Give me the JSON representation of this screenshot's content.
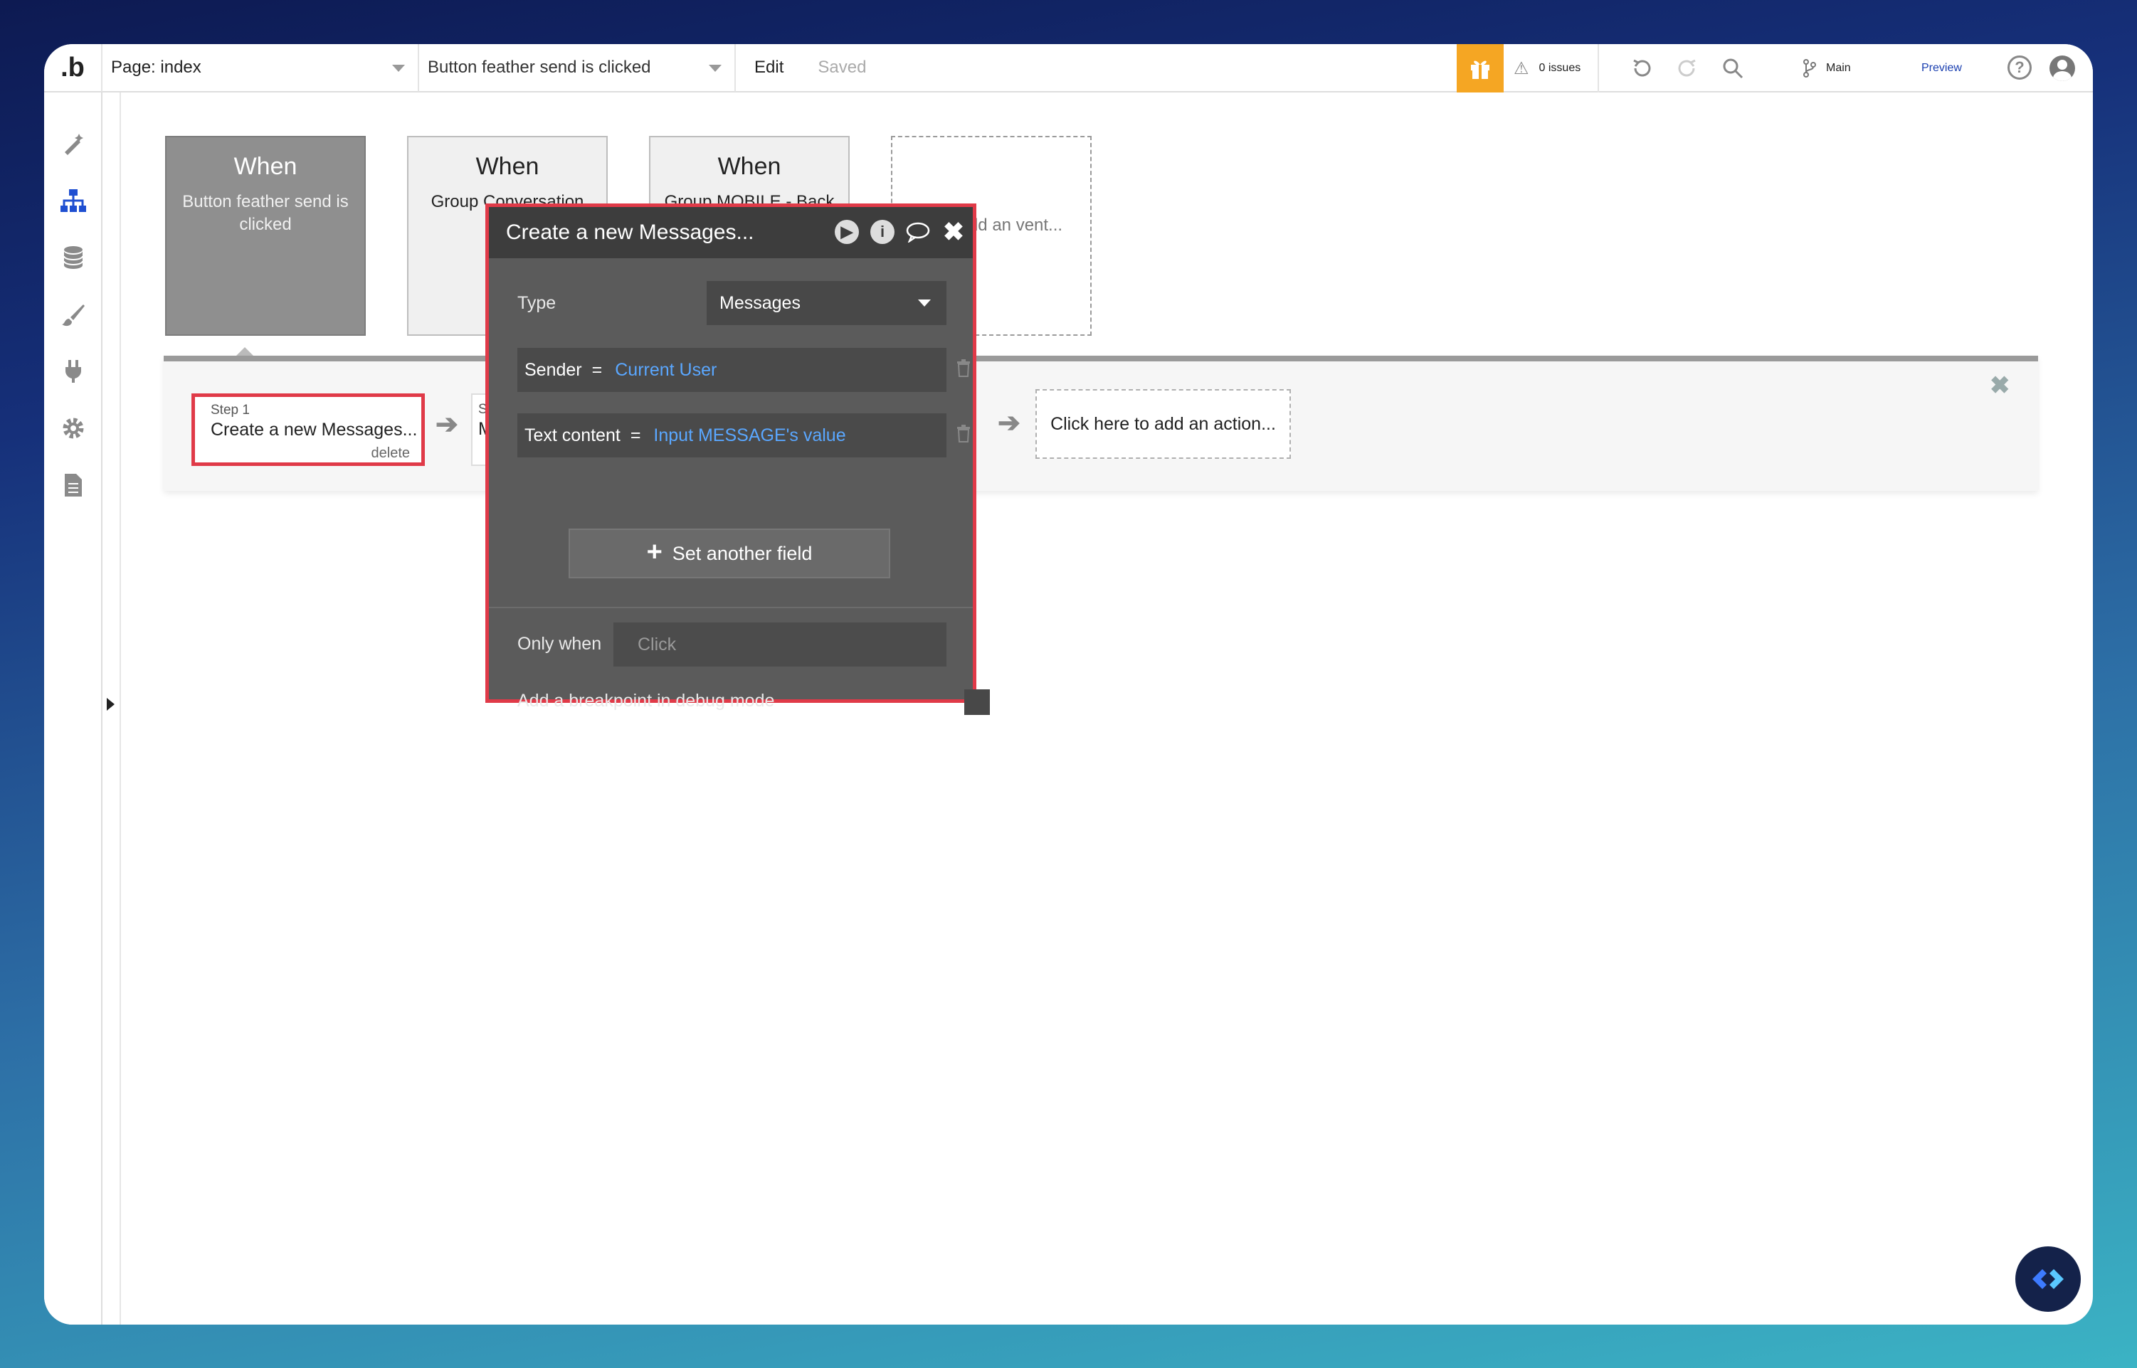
{
  "topbar": {
    "logo": ".b",
    "page_selector": "Page: index",
    "workflow_selector": "Button feather send is clicked",
    "edit": "Edit",
    "saved": "Saved",
    "issues": "0 issues",
    "branch": "Main",
    "preview": "Preview",
    "help": "?"
  },
  "events": [
    {
      "when": "When",
      "desc": "Button feather send is clicked"
    },
    {
      "when": "When",
      "desc": "Group Conversation Tile"
    },
    {
      "when": "When",
      "desc": "Group MOBILE - Back"
    }
  ],
  "add_event": "re to add an vent...",
  "steps": {
    "step1_number": "Step 1",
    "step1_title": "Create a new Messages...",
    "step1_delete": "delete",
    "step2_number": "S",
    "step2_title": "M",
    "add_action": "Click here to add an action..."
  },
  "popup": {
    "title": "Create a new Messages...",
    "type_label": "Type",
    "type_value": "Messages",
    "fields": [
      {
        "name": "Sender",
        "eq": "=",
        "value": "Current User"
      },
      {
        "name": "Text content",
        "eq": "=",
        "value": "Input MESSAGE's value"
      }
    ],
    "set_another_field": "Set another field",
    "only_when_label": "Only when",
    "only_when_placeholder": "Click",
    "breakpoint_label": "Add a breakpoint in debug mode"
  },
  "colors": {
    "accent": "#1f4fd1",
    "highlight": "#e03a48",
    "gift": "#f5a623",
    "link_value": "#5aa7ff"
  },
  "icons": {
    "sidebar": [
      "design-icon",
      "workflow-icon",
      "data-icon",
      "styles-icon",
      "plugins-icon",
      "settings-icon",
      "logs-icon"
    ]
  }
}
